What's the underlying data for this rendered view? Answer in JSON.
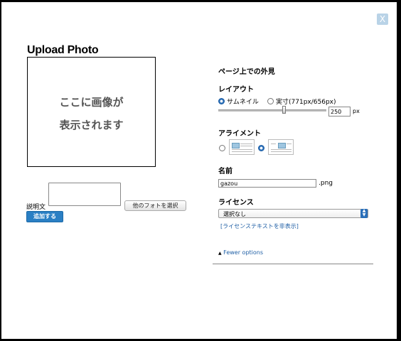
{
  "dialog": {
    "close_label": "X",
    "title": "Upload Photo",
    "preview_line1": "ここに画像が",
    "preview_line2": "表示されます",
    "caption_label": "説明文",
    "other_photo_button": "他のフォトを選択",
    "add_button": "追加する"
  },
  "appearance": {
    "heading": "ページ上での外見",
    "layout": {
      "label": "レイアウト",
      "thumbnail_option": "サムネイル",
      "actual_option": "実寸(771px/656px)",
      "selected": "サムネイル",
      "size_value": "250",
      "size_unit": "px"
    },
    "alignment": {
      "label": "アライメント",
      "selected_index": 1
    },
    "name": {
      "label": "名前",
      "value": "gazou",
      "extension": ".png"
    },
    "license": {
      "label": "ライセンス",
      "selected": "選択なし",
      "hide_link": "[ライセンステキストを非表示]"
    },
    "fewer_options": "Fewer options"
  },
  "colors": {
    "accent": "#2a7fc4",
    "link": "#1f5fa5",
    "close_bg": "#b9d3e7"
  }
}
